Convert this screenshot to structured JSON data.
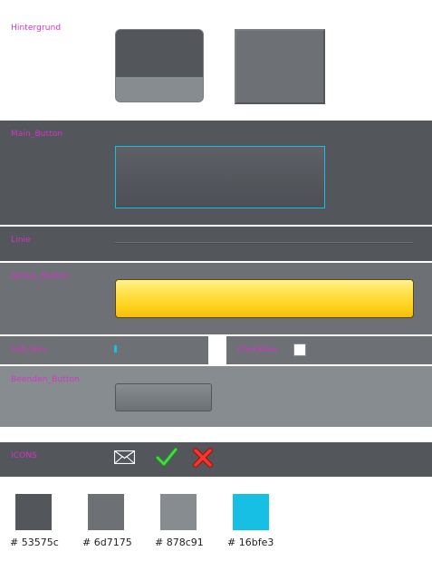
{
  "sections": {
    "hintergrund": "Hintergrund",
    "main_button": "Main_Button",
    "linie": "Linie",
    "aktive_button": "Aktive_Button",
    "sub_nav": "Sub_Nav",
    "checkbox": "Checkbox",
    "beenden_button": "Beenden_Button",
    "icons": "ICONS"
  },
  "icons": [
    "mail-icon",
    "check-icon",
    "close-icon"
  ],
  "palette": [
    {
      "label": "# 53575c",
      "color": "#53575c"
    },
    {
      "label": "# 6d7175",
      "color": "#6d7175"
    },
    {
      "label": "# 878c91",
      "color": "#878c91"
    },
    {
      "label": "# 16bfe3",
      "color": "#16bfe3"
    }
  ],
  "colors": {
    "label": "#d633c8",
    "accent": "#16bfe3",
    "active_yellow": "#ffd21c"
  }
}
